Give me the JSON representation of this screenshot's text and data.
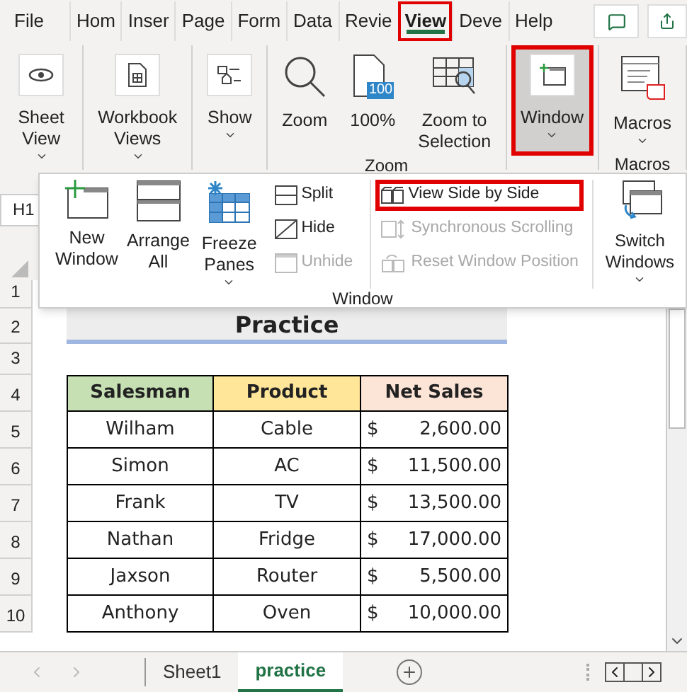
{
  "tabs": [
    {
      "label": "File",
      "selected": false,
      "annotated": false
    },
    {
      "label": "Hom",
      "selected": false,
      "annotated": false
    },
    {
      "label": "Inser",
      "selected": false,
      "annotated": false
    },
    {
      "label": "Page",
      "selected": false,
      "annotated": false
    },
    {
      "label": "Form",
      "selected": false,
      "annotated": false
    },
    {
      "label": "Data",
      "selected": false,
      "annotated": false
    },
    {
      "label": "Revie",
      "selected": false,
      "annotated": false
    },
    {
      "label": "View",
      "selected": true,
      "annotated": true
    },
    {
      "label": "Deve",
      "selected": false,
      "annotated": false
    },
    {
      "label": "Help",
      "selected": false,
      "annotated": false
    }
  ],
  "ribbon_groups": [
    {
      "buttons": [
        {
          "kind": "eye",
          "label": "Sheet View",
          "caret": true,
          "selected": false,
          "annotated": false
        }
      ]
    },
    {
      "buttons": [
        {
          "kind": "workbook",
          "label": "Workbook Views",
          "caret": true,
          "selected": false,
          "annotated": false
        }
      ]
    },
    {
      "buttons": [
        {
          "kind": "show",
          "label": "Show",
          "caret": true,
          "selected": false,
          "annotated": false
        }
      ]
    },
    {
      "label": "Zoom",
      "buttons": [
        {
          "kind": "zoom",
          "label": "Zoom",
          "caret": false,
          "selected": false,
          "annotated": false
        },
        {
          "kind": "hundred",
          "label": "100%",
          "icon_text": "100",
          "caret": false,
          "selected": false,
          "annotated": false
        },
        {
          "kind": "zoomsel",
          "label": "Zoom to Selection",
          "caret": false,
          "selected": false,
          "annotated": false
        }
      ]
    },
    {
      "buttons": [
        {
          "kind": "window",
          "label": "Window",
          "caret": true,
          "selected": true,
          "annotated": true
        }
      ]
    },
    {
      "label": "Macros",
      "buttons": [
        {
          "kind": "macros",
          "label": "Macros",
          "caret": true,
          "selected": false,
          "annotated": false
        }
      ]
    }
  ],
  "window_panel": {
    "label": "Window",
    "large_buttons": [
      {
        "kind": "new",
        "label": "New Window",
        "caret": false
      },
      {
        "kind": "arrange",
        "label": "Arrange All",
        "caret": false
      },
      {
        "kind": "freeze",
        "label": "Freeze Panes",
        "caret": true
      }
    ],
    "small_columns": [
      [
        {
          "kind": "split",
          "label": "Split",
          "disabled": false,
          "annotated": false
        },
        {
          "kind": "hide",
          "label": "Hide",
          "disabled": false,
          "annotated": false
        },
        {
          "kind": "unhide",
          "label": "Unhide",
          "disabled": true,
          "annotated": false
        }
      ],
      [
        {
          "kind": "side",
          "label": "View Side by Side",
          "disabled": false,
          "annotated": true
        },
        {
          "kind": "sync",
          "label": "Synchronous Scrolling",
          "disabled": true,
          "annotated": false
        },
        {
          "kind": "reset",
          "label": "Reset Window Position",
          "disabled": true,
          "annotated": false
        }
      ]
    ],
    "switch_button": {
      "label": "Switch Windows",
      "caret": true
    }
  },
  "name_box": "H1",
  "sheet": {
    "row_numbers": [
      "1",
      "2",
      "3",
      "4",
      "5",
      "6",
      "7",
      "8",
      "9",
      "10"
    ],
    "title": "Practice",
    "table": {
      "columns": [
        {
          "label": "Salesman",
          "color": "#c6e0b4"
        },
        {
          "label": "Product",
          "color": "#ffe699"
        },
        {
          "label": "Net Sales",
          "color": "#fce4d6"
        }
      ],
      "rows": [
        {
          "salesman": "Wilham",
          "product": "Cable",
          "currency": "$",
          "net_sales": "2,600.00"
        },
        {
          "salesman": "Simon",
          "product": "AC",
          "currency": "$",
          "net_sales": "11,500.00"
        },
        {
          "salesman": "Frank",
          "product": "TV",
          "currency": "$",
          "net_sales": "13,500.00"
        },
        {
          "salesman": "Nathan",
          "product": "Fridge",
          "currency": "$",
          "net_sales": "17,000.00"
        },
        {
          "salesman": "Jaxson",
          "product": "Router",
          "currency": "$",
          "net_sales": "5,500.00"
        },
        {
          "salesman": "Anthony",
          "product": "Oven",
          "currency": "$",
          "net_sales": "10,000.00"
        }
      ]
    }
  },
  "sheet_tabs": [
    {
      "label": "Sheet1",
      "selected": false
    },
    {
      "label": "practice",
      "selected": true
    }
  ]
}
